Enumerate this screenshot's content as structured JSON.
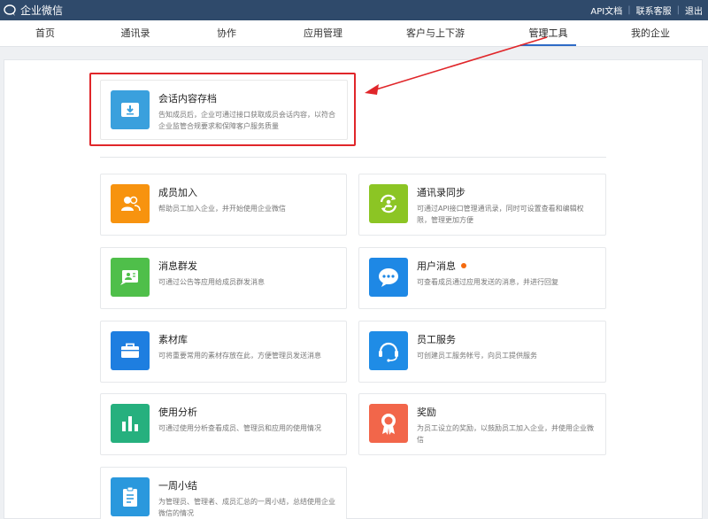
{
  "topbar": {
    "logo_text": "企业微信",
    "links": [
      "API文档",
      "联系客服",
      "退出"
    ]
  },
  "nav": {
    "items": [
      "首页",
      "通讯录",
      "协作",
      "应用管理",
      "客户与上下游",
      "管理工具",
      "我的企业"
    ],
    "active": "管理工具"
  },
  "featured": {
    "title": "会话内容存档",
    "desc": "告知成员后，企业可通过接口获取成员会话内容，以符合企业监管合规要求和保障客户服务质量",
    "icon": "archive-download-icon",
    "color": "#3aa0dd"
  },
  "tools": [
    {
      "title": "成员加入",
      "desc": "帮助员工加入企业，并开始使用企业微信",
      "icon": "members-icon",
      "color": "#f7930f"
    },
    {
      "title": "通讯录同步",
      "desc": "可通过API接口管理通讯录，同时可设置查看和编辑权限，管理更加方便",
      "icon": "sync-icon",
      "color": "#8cc524"
    },
    {
      "title": "消息群发",
      "desc": "可通过公告等应用给成员群发消息",
      "icon": "broadcast-icon",
      "color": "#4fbf4a"
    },
    {
      "title": "用户消息",
      "desc": "可查看成员通过应用发送的消息，并进行回复",
      "icon": "chat-bubble-icon",
      "color": "#1e88e5",
      "badge": true
    },
    {
      "title": "素材库",
      "desc": "可将重要常用的素材存放在此，方便管理员发送消息",
      "icon": "briefcase-icon",
      "color": "#1e7ee0"
    },
    {
      "title": "员工服务",
      "desc": "可创建员工服务帐号，向员工提供服务",
      "icon": "headset-icon",
      "color": "#1f8ce6"
    },
    {
      "title": "使用分析",
      "desc": "可通过使用分析查看成员、管理员和应用的使用情况",
      "icon": "bar-chart-icon",
      "color": "#26b07e"
    },
    {
      "title": "奖励",
      "desc": "为员工设立的奖励，以鼓励员工加入企业，并使用企业微信",
      "icon": "medal-icon",
      "color": "#f2664a"
    },
    {
      "title": "一周小结",
      "desc": "为管理员、管理者、成员汇总的一周小结，总结使用企业微信的情况",
      "icon": "clipboard-icon",
      "color": "#2a98dd"
    }
  ]
}
